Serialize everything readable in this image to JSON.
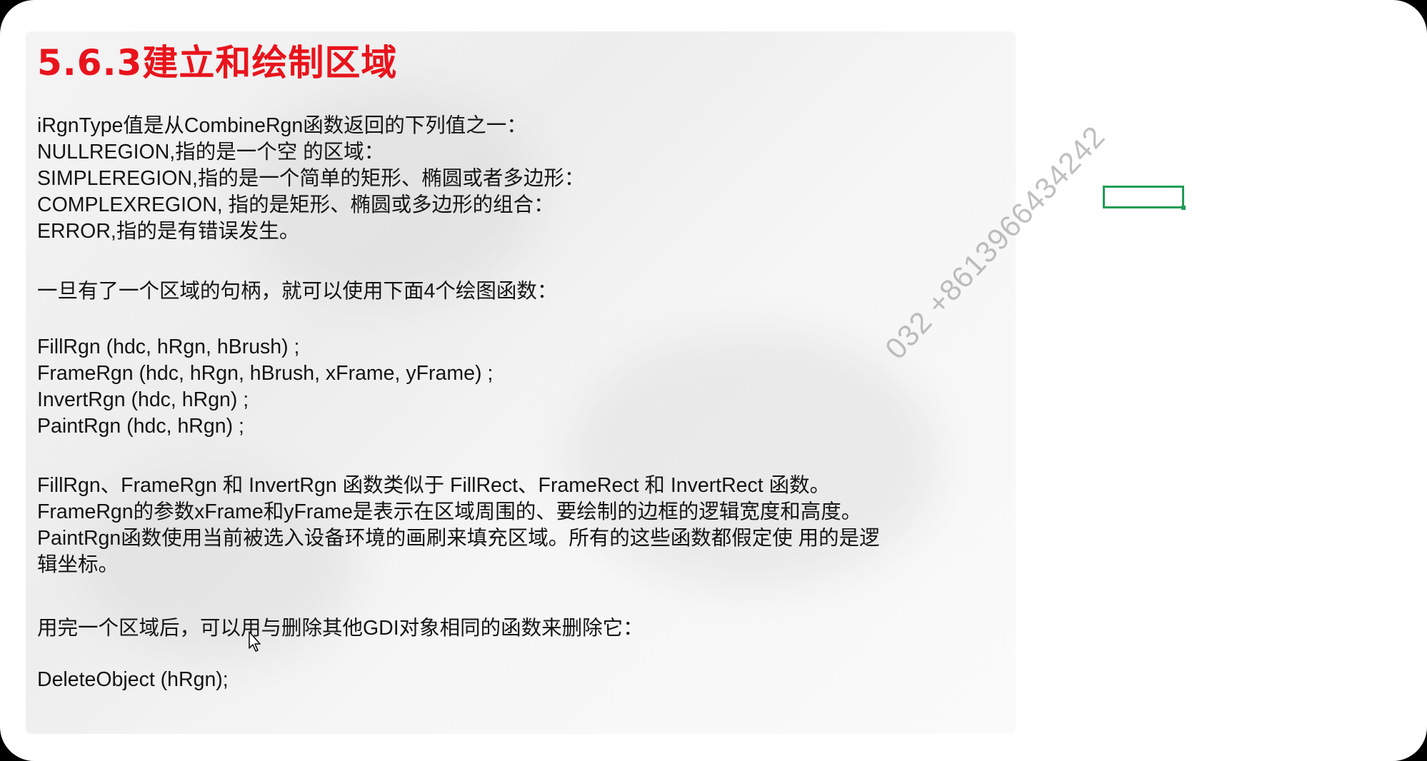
{
  "slide": {
    "title": "5.6.3建立和绘制区域",
    "lines": [
      "iRgnType值是从CombineRgn函数返回的下列值之一：",
      "NULLREGION,指的是一个空 的区域：",
      "SIMPLEREGION,指的是一个简单的矩形、椭圆或者多边形：",
      "COMPLEXREGION, 指的是矩形、椭圆或多边形的组合：",
      "ERROR,指的是有错误发生。",
      "一旦有了一个区域的句柄，就可以使用下面4个绘图函数：",
      "FillRgn (hdc, hRgn, hBrush) ;",
      "FrameRgn (hdc, hRgn, hBrush, xFrame, yFrame) ;",
      "InvertRgn (hdc, hRgn) ;",
      "PaintRgn (hdc, hRgn) ;",
      "FillRgn、FrameRgn 和 InvertRgn 函数类似于 FillRect、FrameRect 和 InvertRect 函数。",
      "FrameRgn的参数xFrame和yFrame是表示在区域周围的、要绘制的边框的逻辑宽度和高度。",
      "PaintRgn函数使用当前被选入设备环境的画刷来填充区域。所有的这些函数都假定使 用的是逻",
      "辑坐标。",
      "用完一个区域后，可以用与删除其他GDI对象相同的函数来删除它：",
      "DeleteObject (hRgn);"
    ]
  },
  "watermark": "032 +8613966434242",
  "colors": {
    "title": "#e8141c",
    "text": "#141414",
    "selection_box": "#1f9d55"
  }
}
